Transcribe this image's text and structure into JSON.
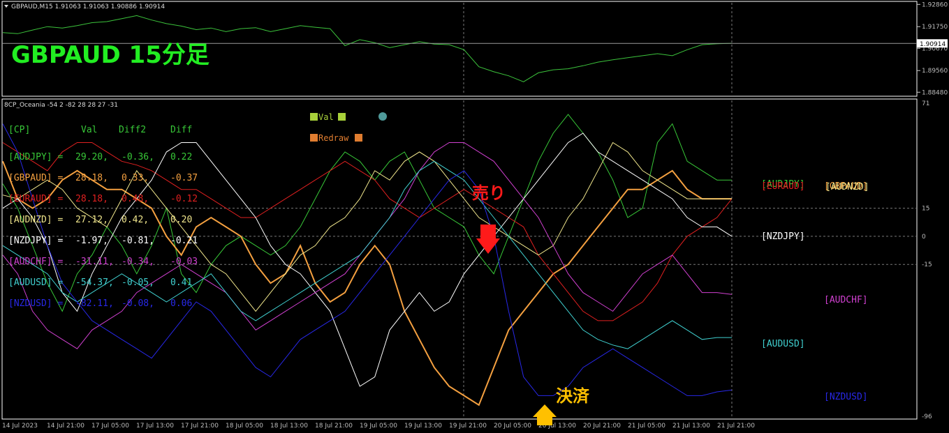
{
  "header": {
    "symbol_label": "GBPAUD,M15  1.91063 1.91063 1.90886 1.90914",
    "indicator_label": "8CP_Oceania -54 2 -82 28 28 27 -31"
  },
  "overlay": {
    "title": "GBPAUD 15分足",
    "sell_label": "売り",
    "close_label": "決済",
    "val_label": "Val",
    "redraw_label": "Redraw"
  },
  "colors": {
    "price": "#3cc43c",
    "title": "#22ee22",
    "sell": "#ff1a1a",
    "close": "#ffc000",
    "grid": "#7a7a7a",
    "axis_text": "#bdbdbd"
  },
  "chart_data": [
    {
      "type": "line",
      "name": "price",
      "ylim": [
        1.8835,
        1.9294
      ],
      "y_ticks": [
        "1.92860",
        "1.91750",
        "1.90670",
        "1.89560",
        "1.88480"
      ],
      "current_price": "1.90914",
      "series": [
        {
          "color": "#3cc43c",
          "values": [
            1.9145,
            1.914,
            1.9158,
            1.9175,
            1.9168,
            1.918,
            1.9195,
            1.92,
            1.9215,
            1.923,
            1.9208,
            1.919,
            1.9178,
            1.916,
            1.9168,
            1.915,
            1.9165,
            1.917,
            1.915,
            1.9165,
            1.918,
            1.9172,
            1.9165,
            1.908,
            1.911,
            1.9095,
            1.907,
            1.9085,
            1.91,
            1.9088,
            1.9085,
            1.906,
            1.8975,
            1.895,
            1.893,
            1.89,
            1.8945,
            1.896,
            1.8965,
            1.898,
            1.8998,
            1.901,
            1.902,
            1.903,
            1.904,
            1.903,
            1.906,
            1.9085,
            1.909,
            1.9092
          ]
        }
      ]
    },
    {
      "type": "line",
      "name": "currency-strength",
      "ylim": [
        -96,
        71
      ],
      "y_ticks": [
        71,
        15,
        0,
        -15,
        -96
      ],
      "x_ticks": [
        "14 Jul 2023",
        "14 Jul 21:00",
        "17 Jul 05:00",
        "17 Jul 13:00",
        "17 Jul 21:00",
        "18 Jul 05:00",
        "18 Jul 13:00",
        "18 Jul 21:00",
        "19 Jul 05:00",
        "19 Jul 13:00",
        "19 Jul 21:00",
        "20 Jul 05:00",
        "20 Jul 13:00",
        "20 Jul 21:00",
        "21 Jul 05:00",
        "21 Jul 13:00",
        "21 Jul 21:00"
      ],
      "table_headers": [
        "[CP]",
        "Val",
        "Diff2",
        "Diff"
      ],
      "table_rows": [
        {
          "name": "[AUDJPY]",
          "val": "29.20,",
          "diff2": "-0.36,",
          "diff": "0.22",
          "color": "#38c838"
        },
        {
          "name": "[GBPAUD]",
          "val": "28.18,",
          "diff2": "0.33,",
          "diff": "-0.37",
          "color": "#f4a040"
        },
        {
          "name": "[EURAUD]",
          "val": "28.18,",
          "diff2": "0.48,",
          "diff": "-0.12",
          "color": "#e02020"
        },
        {
          "name": "[AUDNZD]",
          "val": "27.12,",
          "diff2": "0.42,",
          "diff": "0.20",
          "color": "#f0e68c"
        },
        {
          "name": "[NZDJPY]",
          "val": "-1.97,",
          "diff2": "-0.81,",
          "diff": "-0.21",
          "color": "#ffffff"
        },
        {
          "name": "[AUDCHF]",
          "val": "-31.11,",
          "diff2": "-0.34,",
          "diff": "-0.03",
          "color": "#d040d0"
        },
        {
          "name": "[AUDUSD]",
          "val": "-54.37,",
          "diff2": "-0.05,",
          "diff": "0.41",
          "color": "#40d0d0"
        },
        {
          "name": "[NZDUSD]",
          "val": "-82.11,",
          "diff2": "-0.08,",
          "diff": "0.06",
          "color": "#2828e8"
        }
      ],
      "series_labels": [
        "[AUDJPY]",
        "[GBPAUD]",
        "[EURAUD]",
        "[AUDNZD]",
        "[NZDJPY]",
        "[AUDCHF]",
        "[AUDUSD]",
        "[NZDUSD]"
      ],
      "series": [
        {
          "name": "[AUDJPY]",
          "color": "#38c838",
          "width": 1,
          "values": [
            28,
            15,
            -5,
            -25,
            -40,
            -20,
            -10,
            5,
            -5,
            -20,
            -5,
            15,
            -20,
            -30,
            -15,
            -5,
            0,
            -5,
            -10,
            -5,
            5,
            20,
            35,
            45,
            40,
            30,
            40,
            45,
            30,
            15,
            10,
            5,
            -10,
            -20,
            0,
            20,
            40,
            55,
            65,
            55,
            45,
            30,
            10,
            15,
            50,
            60,
            40,
            35,
            30,
            30
          ]
        },
        {
          "name": "[GBPAUD]",
          "color": "#f4a040",
          "width": 2,
          "values": [
            40,
            20,
            15,
            20,
            30,
            35,
            30,
            25,
            25,
            20,
            15,
            0,
            -10,
            5,
            10,
            5,
            0,
            -15,
            -25,
            -20,
            -5,
            -25,
            -35,
            -30,
            -15,
            -5,
            -15,
            -40,
            -55,
            -70,
            -80,
            -85,
            -90,
            -70,
            -50,
            -40,
            -30,
            -20,
            -15,
            -5,
            5,
            15,
            25,
            25,
            30,
            35,
            25,
            20,
            20,
            20
          ]
        },
        {
          "name": "[EURAUD]",
          "color": "#e02020",
          "width": 1,
          "values": [
            50,
            45,
            40,
            35,
            45,
            50,
            50,
            45,
            40,
            38,
            35,
            30,
            25,
            25,
            20,
            15,
            10,
            10,
            15,
            20,
            25,
            30,
            35,
            40,
            35,
            30,
            20,
            15,
            10,
            15,
            20,
            25,
            20,
            15,
            10,
            5,
            -10,
            -20,
            -30,
            -40,
            -45,
            -45,
            -40,
            -35,
            -25,
            -10,
            0,
            5,
            10,
            20
          ]
        },
        {
          "name": "[AUDNZD]",
          "color": "#f0e68c",
          "width": 1,
          "values": [
            22,
            20,
            25,
            30,
            25,
            15,
            10,
            5,
            20,
            35,
            25,
            15,
            5,
            -5,
            -15,
            -20,
            -30,
            -40,
            -30,
            -20,
            -10,
            -5,
            5,
            10,
            20,
            35,
            30,
            40,
            45,
            40,
            30,
            20,
            10,
            5,
            0,
            -5,
            -10,
            -5,
            10,
            20,
            35,
            50,
            45,
            35,
            30,
            25,
            20,
            20,
            20,
            20
          ]
        },
        {
          "name": "[NZDJPY]",
          "color": "#ffffff",
          "width": 1,
          "values": [
            15,
            20,
            10,
            -5,
            -30,
            -40,
            -20,
            -5,
            10,
            20,
            30,
            45,
            50,
            50,
            40,
            30,
            20,
            10,
            -5,
            -15,
            -20,
            -30,
            -40,
            -60,
            -80,
            -75,
            -50,
            -40,
            -30,
            -40,
            -35,
            -20,
            -10,
            0,
            10,
            20,
            30,
            40,
            50,
            55,
            45,
            40,
            35,
            30,
            25,
            20,
            10,
            5,
            5,
            0
          ]
        },
        {
          "name": "[AUDCHF]",
          "color": "#d040d0",
          "width": 1,
          "values": [
            -10,
            -20,
            -40,
            -50,
            -55,
            -60,
            -50,
            -45,
            -40,
            -30,
            -25,
            -20,
            -15,
            -20,
            -25,
            -30,
            -40,
            -50,
            -45,
            -40,
            -35,
            -30,
            -25,
            -20,
            -10,
            0,
            10,
            20,
            35,
            45,
            50,
            50,
            45,
            40,
            30,
            20,
            10,
            -5,
            -20,
            -30,
            -35,
            -40,
            -30,
            -20,
            -15,
            -10,
            -20,
            -30,
            -30,
            -31
          ]
        },
        {
          "name": "[AUDUSD]",
          "color": "#40d0d0",
          "width": 1,
          "values": [
            -5,
            -10,
            -15,
            -20,
            -30,
            -35,
            -30,
            -25,
            -20,
            -25,
            -30,
            -35,
            -30,
            -25,
            -20,
            -30,
            -40,
            -45,
            -40,
            -35,
            -30,
            -25,
            -20,
            -15,
            -10,
            0,
            10,
            25,
            35,
            40,
            35,
            30,
            20,
            10,
            0,
            -10,
            -20,
            -30,
            -40,
            -50,
            -55,
            -58,
            -60,
            -55,
            -50,
            -45,
            -50,
            -55,
            -54,
            -54
          ]
        },
        {
          "name": "[NZDUSD]",
          "color": "#2828e8",
          "width": 1,
          "values": [
            60,
            45,
            20,
            -5,
            -25,
            -35,
            -45,
            -50,
            -55,
            -60,
            -65,
            -55,
            -45,
            -35,
            -40,
            -50,
            -60,
            -70,
            -75,
            -65,
            -55,
            -50,
            -45,
            -40,
            -30,
            -20,
            -10,
            0,
            10,
            20,
            30,
            35,
            25,
            0,
            -40,
            -75,
            -85,
            -85,
            -80,
            -70,
            -65,
            -60,
            -65,
            -70,
            -75,
            -80,
            -85,
            -85,
            -83,
            -82
          ]
        }
      ]
    }
  ]
}
